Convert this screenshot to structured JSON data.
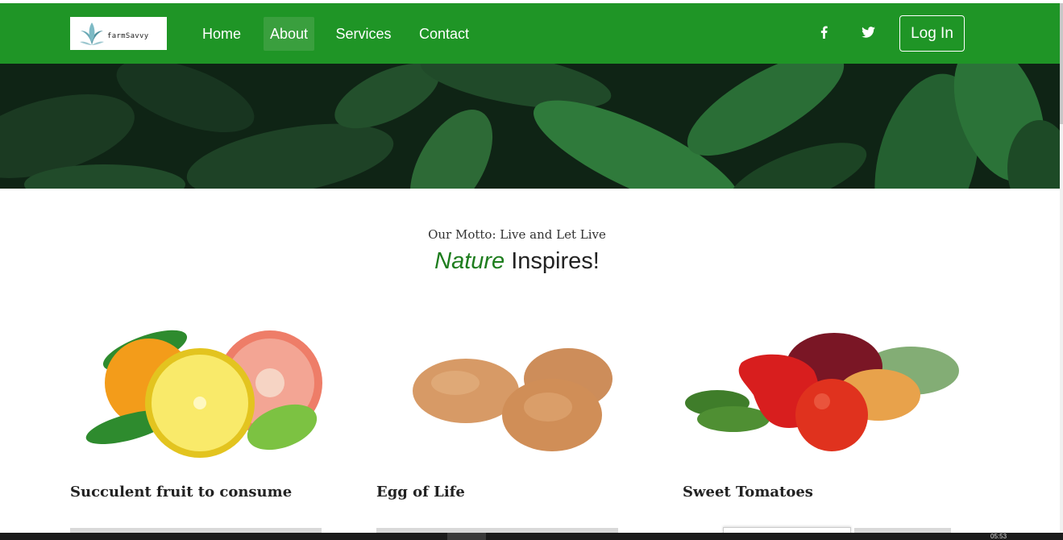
{
  "brand": {
    "logo_text": "farmSavvy"
  },
  "nav": {
    "items": [
      {
        "label": "Home",
        "active": false
      },
      {
        "label": "About",
        "active": true
      },
      {
        "label": "Services",
        "active": false
      },
      {
        "label": "Contact",
        "active": false
      }
    ],
    "login_label": "Log In",
    "social_icons": [
      "facebook-icon",
      "twitter-icon"
    ]
  },
  "main": {
    "motto": "Our Motto: Live and Let Live",
    "headline_emphasis": "Nature",
    "headline_rest": " Inspires!",
    "cards": [
      {
        "title": "Succulent fruit to consume",
        "image": "citrus-fruits"
      },
      {
        "title": "Egg of Life",
        "image": "brown-eggs"
      },
      {
        "title": "Sweet Tomatoes",
        "image": "vegetables"
      }
    ]
  },
  "taskbar": {
    "clock": "05:53"
  },
  "colors": {
    "navbar": "#1f9526",
    "accent_italic": "#1e7d1e",
    "hero": "#102716"
  }
}
